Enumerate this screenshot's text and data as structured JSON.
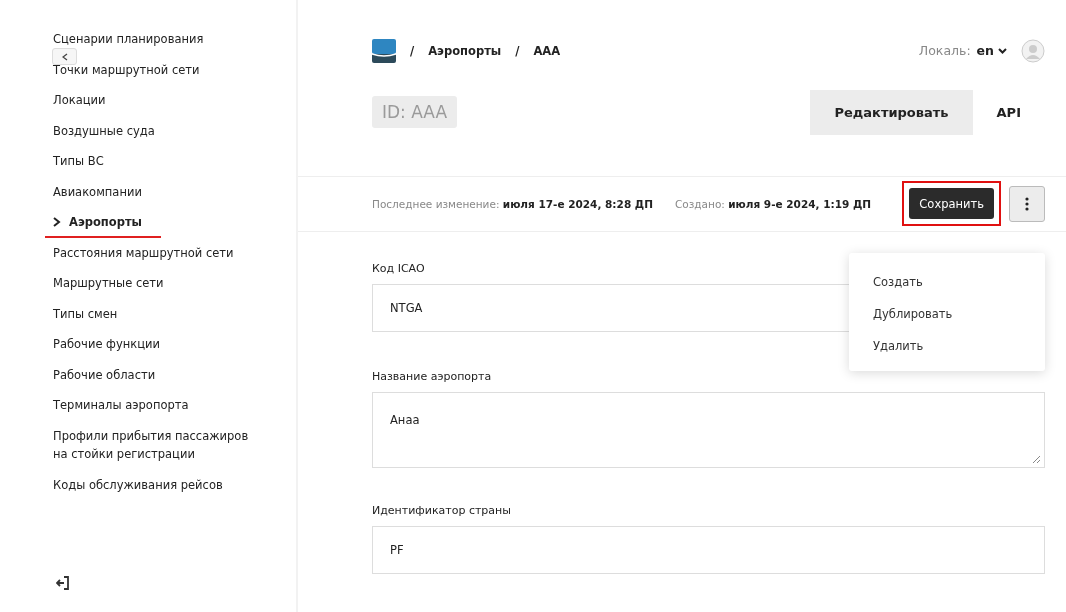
{
  "sidebar": {
    "items": [
      {
        "label": "Сценарии планирования",
        "selected": false
      },
      {
        "label": "Точки маршрутной сети",
        "selected": false
      },
      {
        "label": "Локации",
        "selected": false
      },
      {
        "label": "Воздушные суда",
        "selected": false
      },
      {
        "label": "Типы ВС",
        "selected": false
      },
      {
        "label": "Авиакомпании",
        "selected": false
      },
      {
        "label": "Аэропорты",
        "selected": true
      },
      {
        "label": "Расстояния маршрутной сети",
        "selected": false
      },
      {
        "label": "Маршрутные сети",
        "selected": false
      },
      {
        "label": "Типы смен",
        "selected": false
      },
      {
        "label": "Рабочие функции",
        "selected": false
      },
      {
        "label": "Рабочие области",
        "selected": false
      },
      {
        "label": "Терминалы аэропорта",
        "selected": false
      },
      {
        "label": "Профили прибытия пассажиров на стойки регистрации",
        "selected": false
      },
      {
        "label": "Коды обслуживания рейсов",
        "selected": false
      }
    ]
  },
  "breadcrumbs": [
    "/",
    "Аэропорты",
    "/",
    "AAA"
  ],
  "locale": {
    "label": "Локаль:",
    "value": "en"
  },
  "id_badge": "ID: AAA",
  "actions": [
    "Редактировать",
    "API"
  ],
  "meta": [
    {
      "label": "Последнее изменение:",
      "value": "июля 17-е 2024, 8:28 ДП"
    },
    {
      "label": "Создано:",
      "value": "июля 9-е 2024, 1:19 ДП"
    }
  ],
  "save_button": {
    "label": "Сохранить",
    "highlighted": true
  },
  "menu": {
    "expanded": true,
    "items": [
      "Создать",
      "Дублировать",
      "Удалить"
    ]
  },
  "fields": [
    {
      "kind": "input",
      "label": "Код ICAO",
      "value": "NTGA"
    },
    {
      "kind": "textarea",
      "label": "Название аэропорта",
      "value": "Анаа"
    },
    {
      "kind": "input",
      "label": "Идентификатор страны",
      "value": "PF"
    }
  ]
}
